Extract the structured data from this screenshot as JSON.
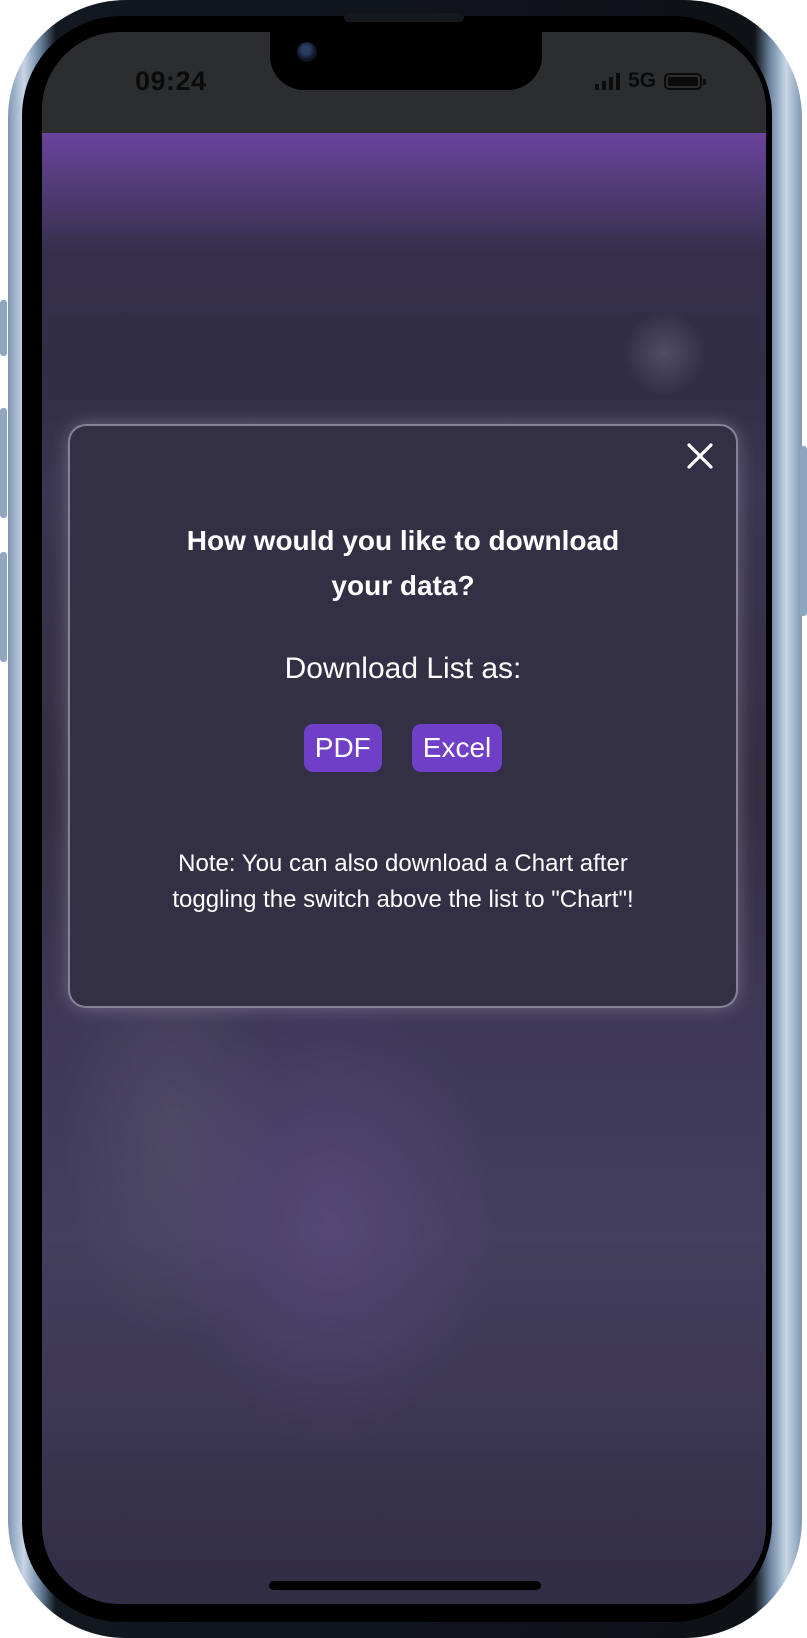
{
  "status_bar": {
    "time": "09:24",
    "network": "5G",
    "icons": [
      "signal-icon",
      "battery-icon"
    ]
  },
  "modal": {
    "close_icon": "close-icon",
    "title_line1": "How would you like to download",
    "title_line2": "your data?",
    "download_label": "Download List as:",
    "buttons": [
      {
        "label": "PDF"
      },
      {
        "label": "Excel"
      }
    ],
    "note_line1": "Note: You can also download a Chart after",
    "note_line2": "toggling the switch above the list to \"Chart\"!"
  },
  "colors": {
    "accent": "#6f3fc7",
    "modal_background": "#332f45",
    "header_purple": "#7548ad"
  }
}
